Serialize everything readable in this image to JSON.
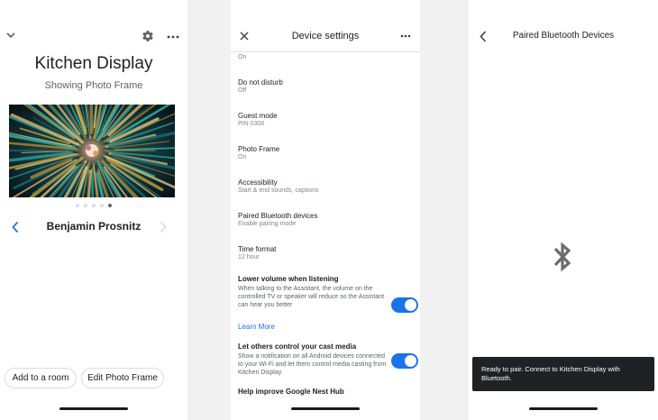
{
  "home": {
    "title": "Kitchen Display",
    "subtitle": "Showing Photo Frame",
    "photographer": "Benjamin Prosnitz",
    "page_dots": 5,
    "active_dot": 4,
    "add_room_label": "Add to a room",
    "edit_photo_label": "Edit Photo Frame"
  },
  "settings": {
    "title": "Device settings",
    "rows": [
      {
        "title": "",
        "sub": "On"
      },
      {
        "title": "Do not disturb",
        "sub": "Off"
      },
      {
        "title": "Guest mode",
        "sub": "PIN 0308"
      },
      {
        "title": "Photo Frame",
        "sub": "On"
      },
      {
        "title": "Accessibility",
        "sub": "Start & end sounds, captions"
      },
      {
        "title": "Paired Bluetooth devices",
        "sub": "Enable pairing mode"
      },
      {
        "title": "Time format",
        "sub": "12 hour"
      }
    ],
    "lower_volume": {
      "title": "Lower volume when listening",
      "desc": "When talking to the Assistant, the volume on the controlled TV or speaker will reduce so the Assistant can hear you better",
      "enabled": true
    },
    "learn_more": "Learn More",
    "cast_media": {
      "title": "Let others control your cast media",
      "desc": "Show a notification on all Android devices connected to your Wi-Fi and let them control media casting from Kitchen Display",
      "enabled": true
    },
    "help_improve": "Help improve Google Nest Hub"
  },
  "bluetooth": {
    "title": "Paired Bluetooth Devices",
    "snackbar": "Ready to pair. Connect to Kitchen Display with Bluetooth."
  },
  "colors": {
    "accent": "#1a73e8",
    "snackbar_bg": "#202124",
    "bt_icon": "#6d6d6d"
  }
}
